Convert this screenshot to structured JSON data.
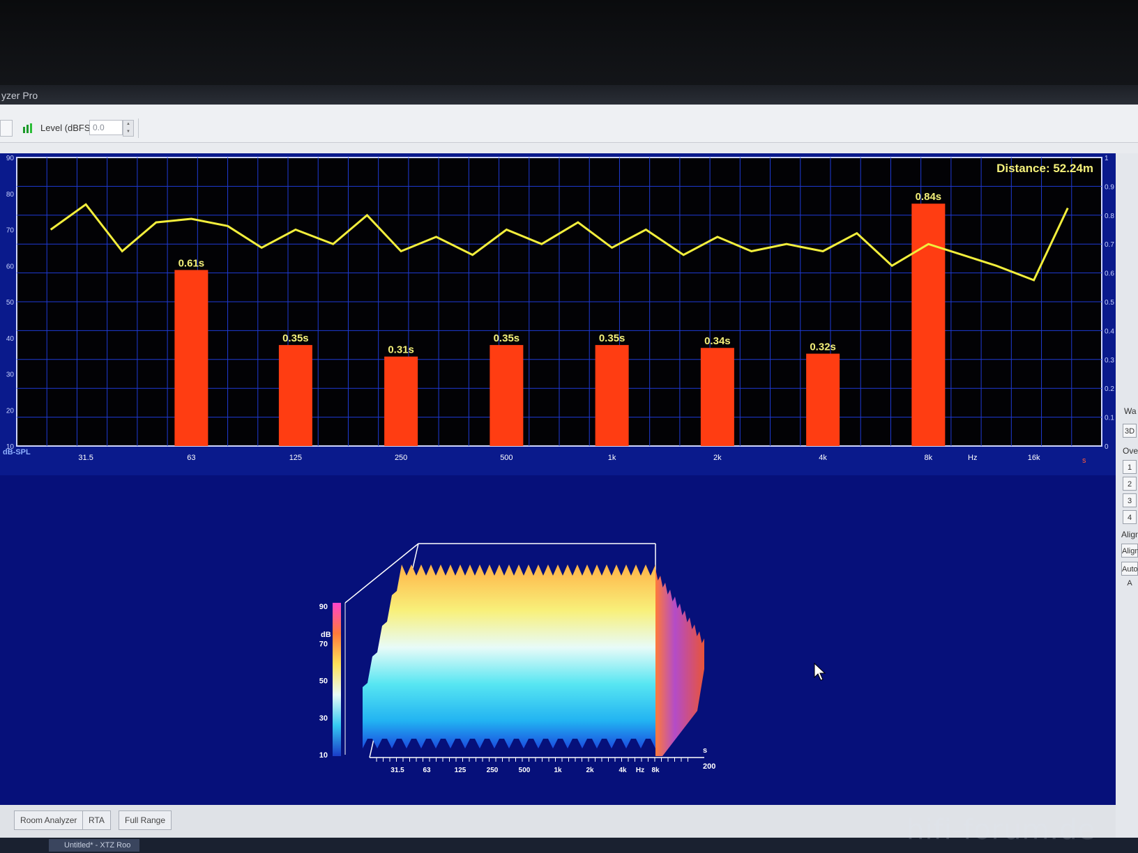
{
  "window": {
    "title": "yzer Pro"
  },
  "toolbar": {
    "level_label": "Level (dBFS)",
    "level_value": "0.0"
  },
  "rta": {
    "distance_label": "Distance: 52.24m",
    "left_axis_unit": "dB-SPL",
    "right_axis_unit": "s",
    "x_unit": "Hz",
    "left_ticks": [
      "90",
      "80",
      "70",
      "60",
      "50",
      "40",
      "30",
      "20",
      "10"
    ],
    "right_ticks": [
      "1",
      "0.9",
      "0.8",
      "0.7",
      "0.6",
      "0.5",
      "0.4",
      "0.3",
      "0.2",
      "0.1",
      "0"
    ],
    "x_ticks": [
      "31.5",
      "63",
      "125",
      "250",
      "500",
      "1k",
      "2k",
      "4k",
      "8k",
      "16k"
    ],
    "line_color": "#f2ee3c",
    "bar_color": "#ff3d12"
  },
  "chart_data": [
    {
      "type": "bar",
      "categories": [
        "63",
        "125",
        "250",
        "500",
        "1k",
        "2k",
        "4k",
        "8k"
      ],
      "values": [
        0.61,
        0.35,
        0.31,
        0.35,
        0.35,
        0.34,
        0.32,
        0.84
      ],
      "labels": [
        "0.61s",
        "0.35s",
        "0.31s",
        "0.35s",
        "0.35s",
        "0.34s",
        "0.32s",
        "0.84s"
      ],
      "ylabel": "s",
      "ylim": [
        0,
        1
      ]
    },
    {
      "type": "line",
      "x": [
        25,
        31.5,
        40,
        50,
        63,
        80,
        100,
        125,
        160,
        200,
        250,
        315,
        400,
        500,
        630,
        800,
        1000,
        1250,
        1600,
        2000,
        2500,
        3150,
        4000,
        5000,
        6300,
        8000,
        10000,
        12500,
        16000,
        20000
      ],
      "y": [
        70,
        77,
        64,
        72,
        73,
        71,
        65,
        70,
        66,
        74,
        64,
        68,
        63,
        70,
        66,
        72,
        65,
        70,
        63,
        68,
        64,
        66,
        64,
        69,
        60,
        66,
        63,
        60,
        56,
        76
      ],
      "ylabel": "dB-SPL",
      "ylim": [
        10,
        90
      ]
    }
  ],
  "waterfall": {
    "zlabel": "dB",
    "z_ticks": [
      "90",
      "70",
      "50",
      "30",
      "10"
    ],
    "x_ticks": [
      "31.5",
      "63",
      "125",
      "250",
      "500",
      "1k",
      "2k",
      "4k",
      "Hz",
      "8k"
    ],
    "time_label": "s",
    "time_end": "200"
  },
  "right_panel": {
    "wa_label": "Wa",
    "btn_3d": "3D",
    "ove_label": "Ove",
    "btn1": "1",
    "btn2": "2",
    "btn3": "3",
    "btn4": "4",
    "align_label": "Alignn",
    "align_btn": "Align",
    "auto_btn": "Auto A"
  },
  "tabs": [
    "Room Analyzer",
    "RTA",
    "Full Range"
  ],
  "taskbar": {
    "item": "Untitled* - XTZ Roo"
  },
  "watermark": "hifi-forum.de"
}
